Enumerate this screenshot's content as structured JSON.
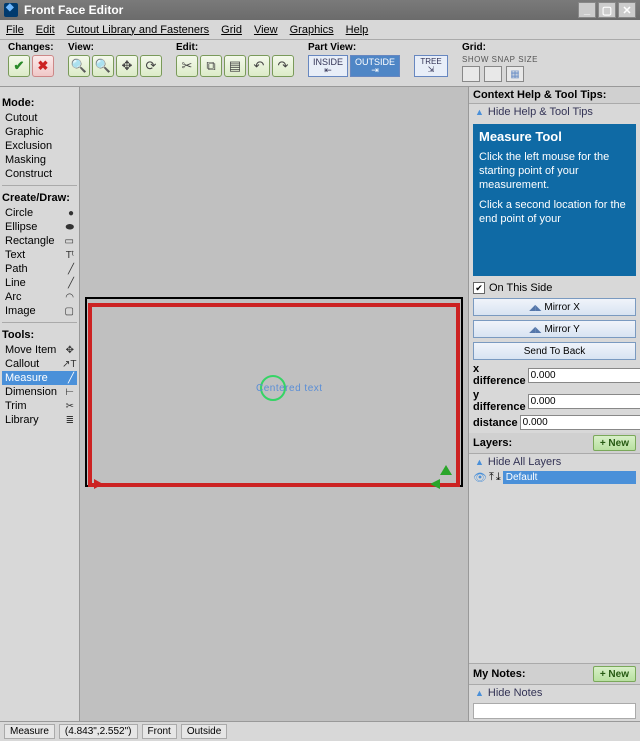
{
  "window": {
    "title": "Front Face Editor"
  },
  "menu": [
    "File",
    "Edit",
    "Cutout Library and Fasteners",
    "Grid",
    "View",
    "Graphics",
    "Help"
  ],
  "toolbar": {
    "changes": {
      "label": "Changes:",
      "accept": "✔",
      "cancel": "✖"
    },
    "view": {
      "label": "View:"
    },
    "edit": {
      "label": "Edit:"
    },
    "partview": {
      "label": "Part View:",
      "inside": "INSIDE",
      "outside": "OUTSIDE",
      "tree": "TREE"
    },
    "grid": {
      "label": "Grid:",
      "show": "SHOW",
      "snap": "SNAP",
      "size": "SIZE"
    }
  },
  "left": {
    "mode": {
      "label": "Mode:",
      "items": [
        "Cutout",
        "Graphic",
        "Exclusion",
        "Masking",
        "Construct"
      ]
    },
    "create": {
      "label": "Create/Draw:",
      "items": [
        {
          "t": "Circle",
          "i": "●"
        },
        {
          "t": "Ellipse",
          "i": "⬬"
        },
        {
          "t": "Rectangle",
          "i": "▭"
        },
        {
          "t": "Text",
          "i": "Tᵗ"
        },
        {
          "t": "Path",
          "i": "╱"
        },
        {
          "t": "Line",
          "i": "╱"
        },
        {
          "t": "Arc",
          "i": "◠"
        },
        {
          "t": "Image",
          "i": "▢"
        }
      ]
    },
    "tools": {
      "label": "Tools:",
      "items": [
        {
          "t": "Move Item",
          "i": "✥"
        },
        {
          "t": "Callout",
          "i": "↗T"
        },
        {
          "t": "Measure",
          "i": "╱",
          "sel": true
        },
        {
          "t": "Dimension",
          "i": "⊢"
        },
        {
          "t": "Trim",
          "i": "✂"
        },
        {
          "t": "Library",
          "i": "≣"
        }
      ]
    }
  },
  "canvas": {
    "centered_text": "Centered text"
  },
  "right": {
    "context_title": "Context Help & Tool Tips:",
    "hide_help": "Hide Help & Tool Tips",
    "help_title": "Measure Tool",
    "help_body1": "Click the left mouse for the starting point of your measurement.",
    "help_body2": "Click a second location for the end point of your",
    "on_this_side": "On This Side",
    "mirror_x": "Mirror X",
    "mirror_y": "Mirror Y",
    "send_back": "Send To Back",
    "xdiff": {
      "label": "x difference",
      "value": "0.000"
    },
    "ydiff": {
      "label": "y difference",
      "value": "0.000"
    },
    "dist": {
      "label": "distance",
      "value": "0.000"
    },
    "layers_label": "Layers:",
    "new": "+ New",
    "hide_layers": "Hide All Layers",
    "layer_default": "Default",
    "notes_label": "My Notes:",
    "hide_notes": "Hide Notes"
  },
  "status": {
    "tool": "Measure",
    "coords": "(4.843\",2.552\")",
    "face": "Front",
    "side": "Outside"
  }
}
